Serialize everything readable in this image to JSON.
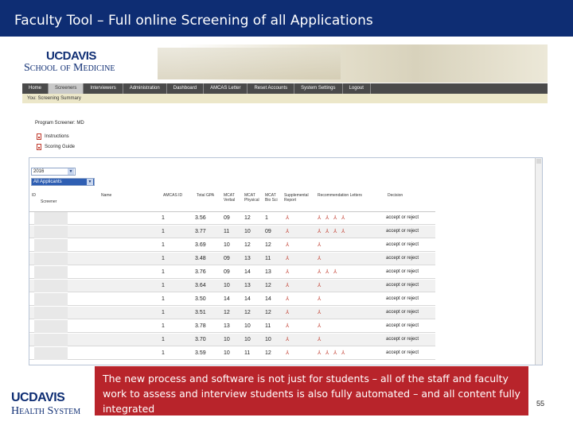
{
  "slide": {
    "title": "Faculty Tool – Full online Screening of all Applications",
    "caption": "The new process and software is not just for students – all of the staff and faculty work to assess and interview students is also fully automated – and all content fully integrated",
    "page_number": "55",
    "footer_logo": {
      "line1": "UCDAVIS",
      "line2": "Health System"
    }
  },
  "app": {
    "logo": {
      "line1": "UCDAVIS",
      "line2": "School of Medicine"
    },
    "nav": [
      "Home",
      "Screeners",
      "Interviewers",
      "Administration",
      "Dashboard",
      "AMCAS Letter",
      "Reset Accounts",
      "System Settings",
      "Logout"
    ],
    "active_nav": "Screeners",
    "breadcrumb": "You: Screening Summary",
    "program_label": "Program Screener: MD",
    "links": [
      "Instructions",
      "Scoring Guide"
    ],
    "year_select": "2016",
    "filter_select": "All Applicants",
    "table": {
      "headers": [
        "ID",
        "Screener",
        "Name",
        "AMCAS ID",
        "Total GPA",
        "MCAT Verbal",
        "MCAT Physical",
        "MCAT Bio Sci",
        "Supplemental Report",
        "Recommendation Letters",
        "Decision"
      ],
      "rows": [
        {
          "col1": "1",
          "gpa": "3.56",
          "m1": "09",
          "m2": "12",
          "m3": "1",
          "letters": 4,
          "decision": "accept or reject"
        },
        {
          "col1": "1",
          "gpa": "3.77",
          "m1": "11",
          "m2": "10",
          "m3": "09",
          "letters": 4,
          "decision": "accept or reject"
        },
        {
          "col1": "1",
          "gpa": "3.69",
          "m1": "10",
          "m2": "12",
          "m3": "12",
          "letters": 1,
          "decision": "accept or reject"
        },
        {
          "col1": "1",
          "gpa": "3.48",
          "m1": "09",
          "m2": "13",
          "m3": "11",
          "letters": 1,
          "decision": "accept or reject"
        },
        {
          "col1": "1",
          "gpa": "3.76",
          "m1": "09",
          "m2": "14",
          "m3": "13",
          "letters": 3,
          "decision": "accept or reject"
        },
        {
          "col1": "1",
          "gpa": "3.64",
          "m1": "10",
          "m2": "13",
          "m3": "12",
          "letters": 1,
          "decision": "accept or reject"
        },
        {
          "col1": "1",
          "gpa": "3.50",
          "m1": "14",
          "m2": "14",
          "m3": "14",
          "letters": 1,
          "decision": "accept or reject"
        },
        {
          "col1": "1",
          "gpa": "3.51",
          "m1": "12",
          "m2": "12",
          "m3": "12",
          "letters": 1,
          "decision": "accept or reject"
        },
        {
          "col1": "1",
          "gpa": "3.78",
          "m1": "13",
          "m2": "10",
          "m3": "11",
          "letters": 1,
          "decision": "accept or reject"
        },
        {
          "col1": "1",
          "gpa": "3.70",
          "m1": "10",
          "m2": "10",
          "m3": "10",
          "letters": 1,
          "decision": "accept or reject"
        },
        {
          "col1": "1",
          "gpa": "3.59",
          "m1": "10",
          "m2": "11",
          "m3": "12",
          "letters": 4,
          "decision": "accept or reject"
        }
      ]
    }
  },
  "colors": {
    "title_bar": "#0e2d73",
    "caption_bg": "#b8242b",
    "nav_bg": "#4a4a4a",
    "pdf_red": "#c0392b"
  },
  "icons": {
    "pdf": "pdf-icon",
    "dropdown": "chevron-down-icon"
  }
}
